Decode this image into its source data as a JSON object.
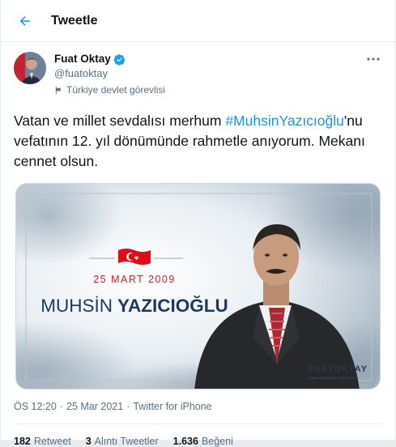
{
  "header": {
    "title": "Tweetle"
  },
  "author": {
    "name": "Fuat Oktay",
    "handle": "@fuatoktay",
    "label": "Türkiye devlet görevlisi"
  },
  "tweet": {
    "text_before": "Vatan ve millet sevdalısı merhum ",
    "hashtag": "#MuhsinYazıcıoğlu",
    "text_after": "'nu vefatının 12. yıl dönümünde rahmetle anıyorum. Mekanı cennet olsun."
  },
  "media": {
    "date": "25 MART 2009",
    "name_first": "MUHSİN",
    "name_last": "YAZICIOĞLU",
    "brand": "FUATOKTAY",
    "brand_sub": "CUMHURBAŞKANI YARDIMCISI"
  },
  "meta": {
    "time": "ÖS 12:20",
    "date": "25 Mar 2021",
    "source": "Twitter for iPhone",
    "separator": "·"
  },
  "stats": {
    "retweets": "182",
    "retweets_label": "Retweet",
    "quotes": "3",
    "quotes_label": "Alıntı Tweetler",
    "likes": "1.636",
    "likes_label": "Beğeni"
  },
  "colors": {
    "link": "#1b95e0",
    "secondary_text": "#5b7083",
    "flag_red": "#e30a17"
  },
  "icons": {
    "back": "arrow-left-icon",
    "verified": "verified-badge-icon",
    "more": "more-options-icon",
    "label": "flag-icon"
  }
}
